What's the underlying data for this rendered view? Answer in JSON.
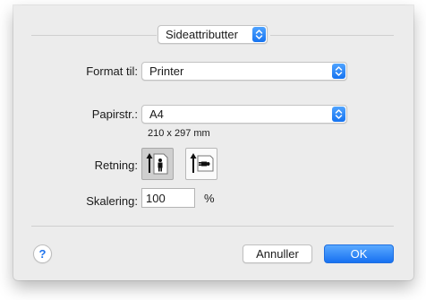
{
  "panel_selector": {
    "value": "Sideattributter"
  },
  "format_for": {
    "label": "Format til:",
    "value": "Printer"
  },
  "paper_size": {
    "label": "Papirstr.:",
    "value": "A4",
    "dimensions": "210 x 297 mm"
  },
  "orientation": {
    "label": "Retning:",
    "options": [
      "portrait",
      "landscape"
    ],
    "selected": "portrait"
  },
  "scale": {
    "label": "Skalering:",
    "value": "100",
    "unit": "%"
  },
  "buttons": {
    "help": "?",
    "cancel": "Annuller",
    "ok": "OK"
  },
  "colors": {
    "accent": "#1673f0",
    "sheet_bg": "#ececec"
  }
}
